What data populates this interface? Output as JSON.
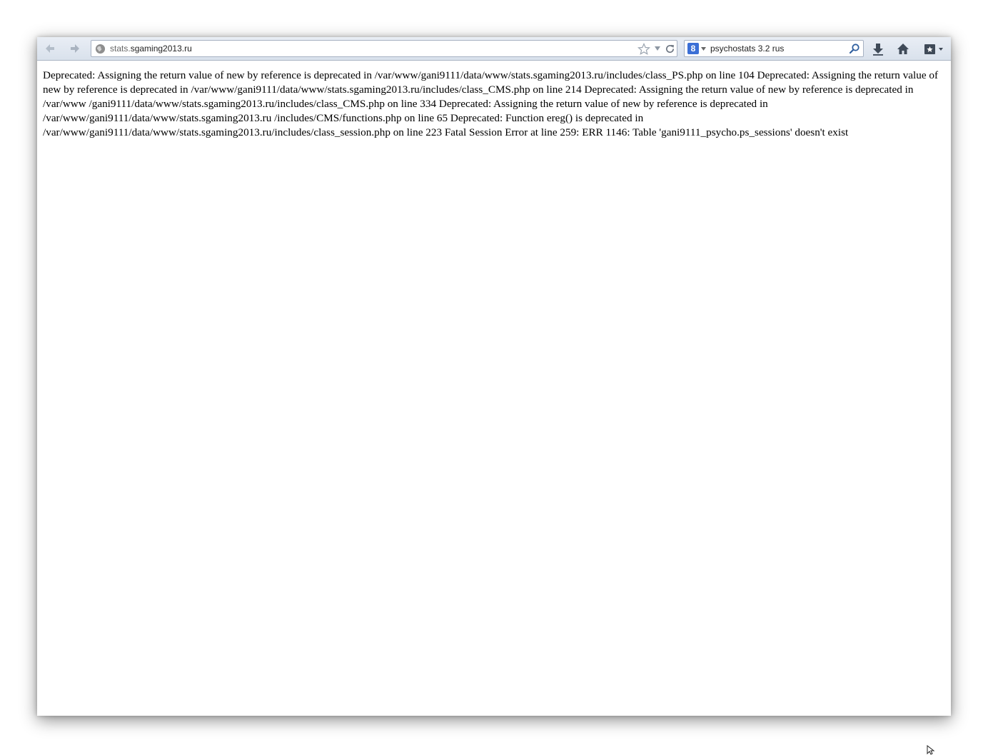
{
  "browser": {
    "url": {
      "prefix": "stats.",
      "domain": "sgaming2013.ru"
    },
    "search": {
      "query": "psychostats 3.2 rus",
      "engine_icon_label": "8"
    },
    "icons": {
      "back": "back-arrow-icon",
      "forward": "forward-arrow-icon",
      "site": "globe-icon",
      "bookmark_star": "star-icon",
      "history_dropdown": "dropdown-icon",
      "reload": "reload-icon",
      "search_engine": "search-engine-icon",
      "search_go": "magnifier-icon",
      "downloads": "download-arrow-icon",
      "home": "home-icon",
      "bookmarks": "bookmarks-icon"
    }
  },
  "page": {
    "error_text": "Deprecated: Assigning the return value of new by reference is deprecated in /var/www/gani9111/data/www/stats.sgaming2013.ru/includes/class_PS.php on line 104 Deprecated: Assigning the return value of new by reference is deprecated in /var/www/gani9111/data/www/stats.sgaming2013.ru/includes/class_CMS.php on line 214 Deprecated: Assigning the return value of new by reference is deprecated in /var/www /gani9111/data/www/stats.sgaming2013.ru/includes/class_CMS.php on line 334 Deprecated: Assigning the return value of new by reference is deprecated in /var/www/gani9111/data/www/stats.sgaming2013.ru /includes/CMS/functions.php on line 65 Deprecated: Function ereg() is deprecated in /var/www/gani9111/data/www/stats.sgaming2013.ru/includes/class_session.php on line 223 Fatal Session Error at line 259: ERR 1146: Table 'gani9111_psycho.ps_sessions' doesn't exist"
  },
  "colors": {
    "toolbar_top": "#e9eef5",
    "toolbar_bottom": "#d9e1ec",
    "search_engine_blue": "#3b6fd6"
  }
}
